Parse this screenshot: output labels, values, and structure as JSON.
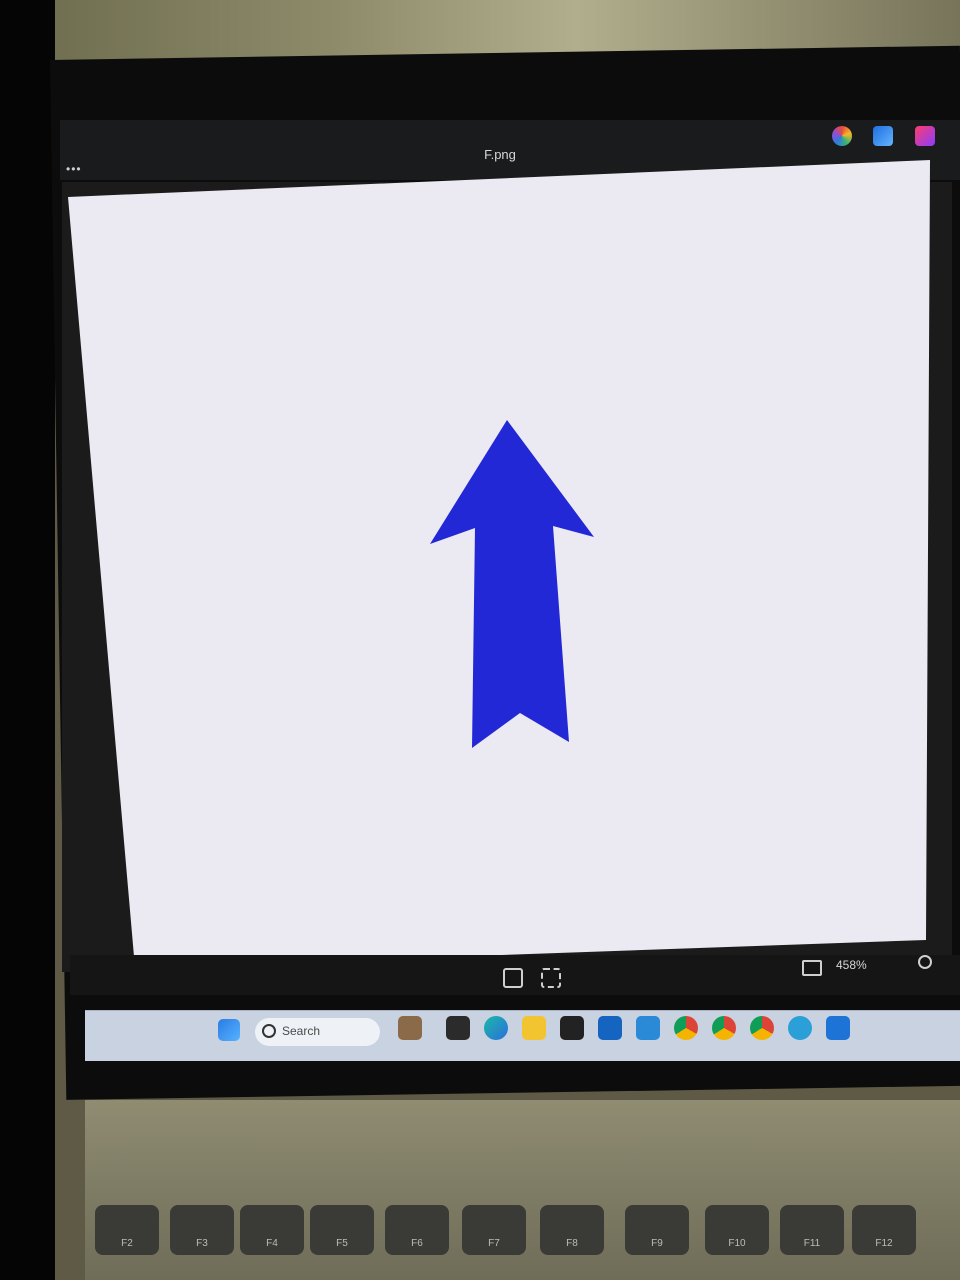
{
  "window": {
    "title": "F.png",
    "menu_dots": "•••"
  },
  "viewer": {
    "zoom": "458%",
    "arrow": {
      "shape": "up-arrow",
      "color": "#2328d6"
    },
    "background_color": "#ebe9f1"
  },
  "taskbar": {
    "search_placeholder": "Search"
  },
  "keyboard": {
    "keys": [
      "F2",
      "F3",
      "F4",
      "F5",
      "F6",
      "F7",
      "F8",
      "F9",
      "F10",
      "F11",
      "F12"
    ]
  },
  "colors": {
    "accent": "#2328d6",
    "titlebar": "#1a1b1d",
    "taskbar": "#c9d2e0"
  }
}
